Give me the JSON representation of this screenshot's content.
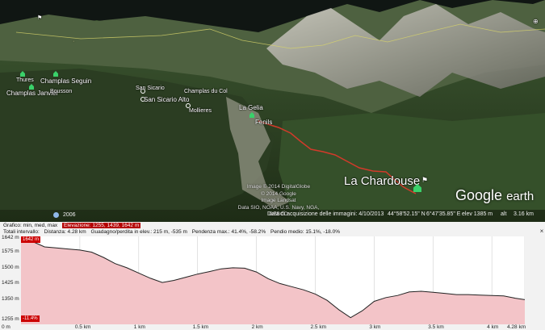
{
  "map": {
    "places": {
      "la_gelia": "La Gelia",
      "fenils": "Fenils",
      "champlas_seguin": "Champlas Seguin",
      "champlas_janvier": "Champlas Janvier",
      "thures": "Thures",
      "san_sicario": "San Sicario",
      "san_sicario_alto": "San Sicario Alto",
      "mollieres": "Mollieres",
      "bousson": "Bousson",
      "champlas_du_col": "Champlas du Col",
      "la_chardouse": "La Chardouse"
    },
    "credits": [
      "Image © 2014 DigitalGlobe",
      "© 2014 Google",
      "Image Landsat",
      "Data SIO, NOAA, U.S. Navy, NGA, GEBCO"
    ],
    "logo": {
      "word1": "Google",
      "word2": "earth"
    },
    "status": {
      "year": "2006",
      "acquisition_date": "Data di acquisizione delle immagini: 4/10/2013",
      "lat": "44°58'52.15\" N",
      "lon": "6°47'35.85\" E",
      "elev": "elev 1385 m",
      "alt": "alt",
      "alt_value": "3.16 km"
    },
    "accent_color": "#d23a2a"
  },
  "profile": {
    "info_line1": {
      "grafico": "Grafico: min, med, max",
      "elevazione": "Elevazione: 1255, 1439, 1642 m"
    },
    "info_line2": {
      "totals": "Totali intervallo:",
      "distanza": "Distanza: 4.28 km",
      "guadagno": "Guadagno/perdita in elev.: 215 m, -535 m",
      "pendenza_max": "Pendenza max.: 41.4%, -58.2%",
      "pendenza_media": "Pendio medio: 15.1%, -18.0%"
    },
    "tags": {
      "top": "1642 m",
      "bottom": "-11.4%"
    },
    "bottom_left": "0 m"
  },
  "chart_data": {
    "type": "area",
    "x": [
      0,
      0.1,
      0.2,
      0.3,
      0.4,
      0.5,
      0.6,
      0.7,
      0.8,
      0.9,
      1.0,
      1.1,
      1.2,
      1.3,
      1.4,
      1.5,
      1.6,
      1.7,
      1.8,
      1.9,
      2.0,
      2.1,
      2.2,
      2.3,
      2.4,
      2.5,
      2.6,
      2.7,
      2.8,
      2.9,
      3.0,
      3.1,
      3.2,
      3.3,
      3.4,
      3.5,
      3.6,
      3.7,
      3.8,
      3.9,
      4.0,
      4.1,
      4.2,
      4.28
    ],
    "y": [
      1642,
      1625,
      1600,
      1595,
      1590,
      1585,
      1575,
      1550,
      1520,
      1500,
      1475,
      1450,
      1430,
      1440,
      1455,
      1470,
      1482,
      1495,
      1500,
      1498,
      1480,
      1448,
      1425,
      1410,
      1395,
      1375,
      1345,
      1300,
      1262,
      1295,
      1340,
      1358,
      1368,
      1385,
      1388,
      1383,
      1378,
      1372,
      1372,
      1370,
      1368,
      1366,
      1355,
      1348
    ],
    "xlabel": "",
    "ylabel": "",
    "xticks": [
      "0 m",
      "0.5 km",
      "1 km",
      "1.5 km",
      "2 km",
      "2.5 km",
      "3 km",
      "3.5 km",
      "4 km",
      "4.28 km"
    ],
    "xtick_values": [
      0,
      0.5,
      1,
      1.5,
      2,
      2.5,
      3,
      3.5,
      4,
      4.28
    ],
    "yticks": [
      "1642 m",
      "1575 m",
      "1500 m",
      "1425 m",
      "1350 m",
      "1255 m"
    ],
    "ytick_values": [
      1642,
      1575,
      1500,
      1425,
      1350,
      1255
    ],
    "xlim": [
      0,
      4.28
    ],
    "ylim": [
      1230,
      1650
    ],
    "grid": true,
    "fill_color": "#f3c4c8",
    "line_color": "#222222"
  }
}
